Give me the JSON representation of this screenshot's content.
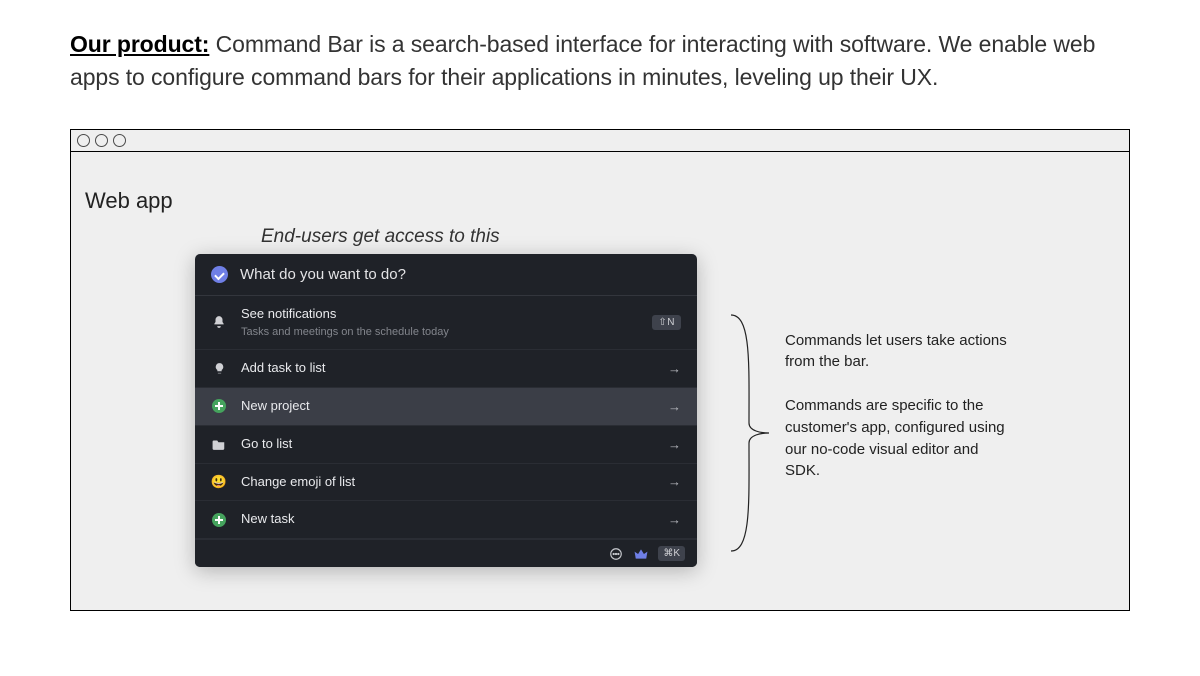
{
  "headline": {
    "lead": "Our product:",
    "rest": " Command Bar is a search-based interface for interacting with software. We enable web apps to configure command bars for their applications in minutes, leveling up their UX."
  },
  "window": {
    "app_label": "Web app",
    "caption": "End-users get access to this"
  },
  "command_bar": {
    "placeholder": "What do you want to do?",
    "shortcut_badge": "⇧N",
    "footer_shortcut": "⌘K",
    "commands": [
      {
        "icon": "bell",
        "title": "See notifications",
        "subtitle": "Tasks and meetings on the schedule today",
        "right": "badge"
      },
      {
        "icon": "bulb",
        "title": "Add task to list",
        "right": "arrow"
      },
      {
        "icon": "plus",
        "title": "New project",
        "right": "arrow",
        "selected": true
      },
      {
        "icon": "folder",
        "title": "Go to list",
        "right": "arrow"
      },
      {
        "icon": "emoji",
        "title": "Change emoji of list",
        "right": "arrow"
      },
      {
        "icon": "plus",
        "title": "New task",
        "right": "arrow"
      }
    ]
  },
  "annotations": {
    "p1": "Commands let users take actions from the bar.",
    "p2": "Commands are specific to the customer's app, configured using our no-code visual editor and SDK."
  }
}
